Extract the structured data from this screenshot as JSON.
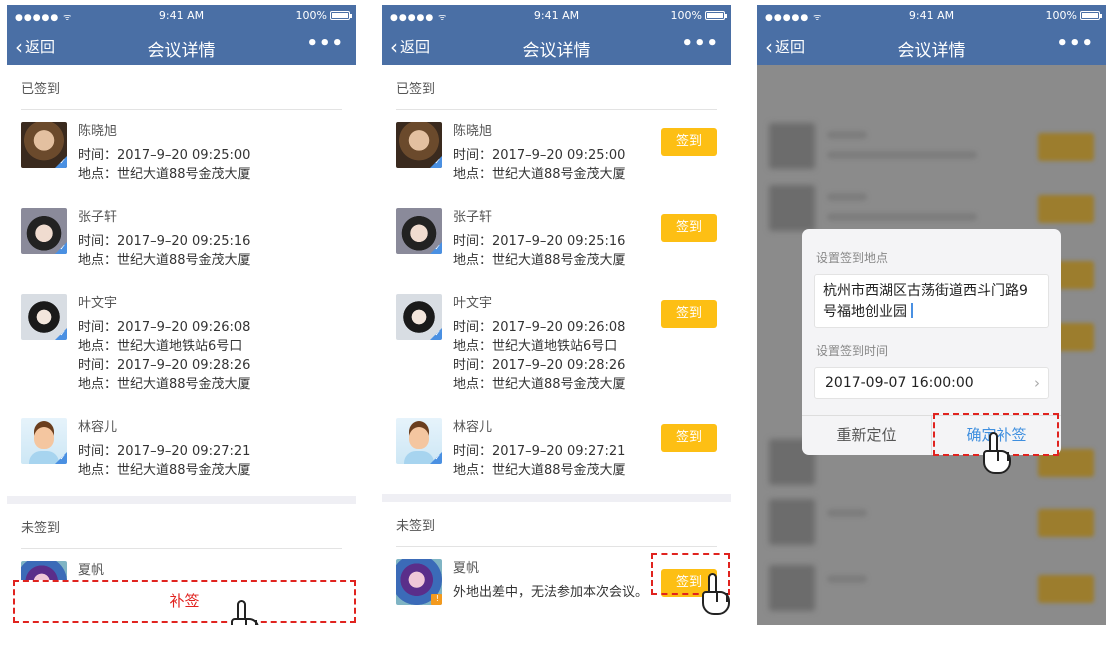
{
  "status": {
    "signal": "●●●●● ᯤ",
    "time": "9:41 AM",
    "battery": "100%"
  },
  "nav": {
    "back": "返回",
    "title": "会议详情",
    "more": "•••"
  },
  "section_signed": "已签到",
  "section_unsigned": "未签到",
  "signed": [
    {
      "name": "陈晓旭",
      "lines": [
        "时间：2017–9–20 09:25:00",
        "地点：世纪大道88号金茂大厦"
      ]
    },
    {
      "name": "张子轩",
      "lines": [
        "时间：2017–9–20 09:25:16",
        "地点：世纪大道88号金茂大厦"
      ]
    },
    {
      "name": "叶文宇",
      "lines": [
        "时间：2017–9–20 09:26:08",
        "地点：世纪大道地铁站6号口",
        "时间：2017–9–20 09:28:26",
        "地点：世纪大道88号金茂大厦"
      ]
    },
    {
      "name": "林容儿",
      "lines": [
        "时间：2017–9–20 09:27:21",
        "地点：世纪大道88号金茂大厦"
      ]
    }
  ],
  "unsigned": [
    {
      "name": "夏帆",
      "note": "外地出差中，无法参加本次会议。"
    }
  ],
  "sign_button": "签到",
  "makeup_button": "补签",
  "dialog": {
    "location_label": "设置签到地点",
    "location_value": "杭州市西湖区古荡街道西斗门路9号福地创业园",
    "time_label": "设置签到时间",
    "time_value": "2017-09-07 16:00:00",
    "relocate": "重新定位",
    "confirm": "确定补签"
  },
  "colors": {
    "nav": "#4a6fa5",
    "sign": "#fdbf14",
    "highlight": "#e0231f",
    "confirm": "#3f8fdf"
  }
}
